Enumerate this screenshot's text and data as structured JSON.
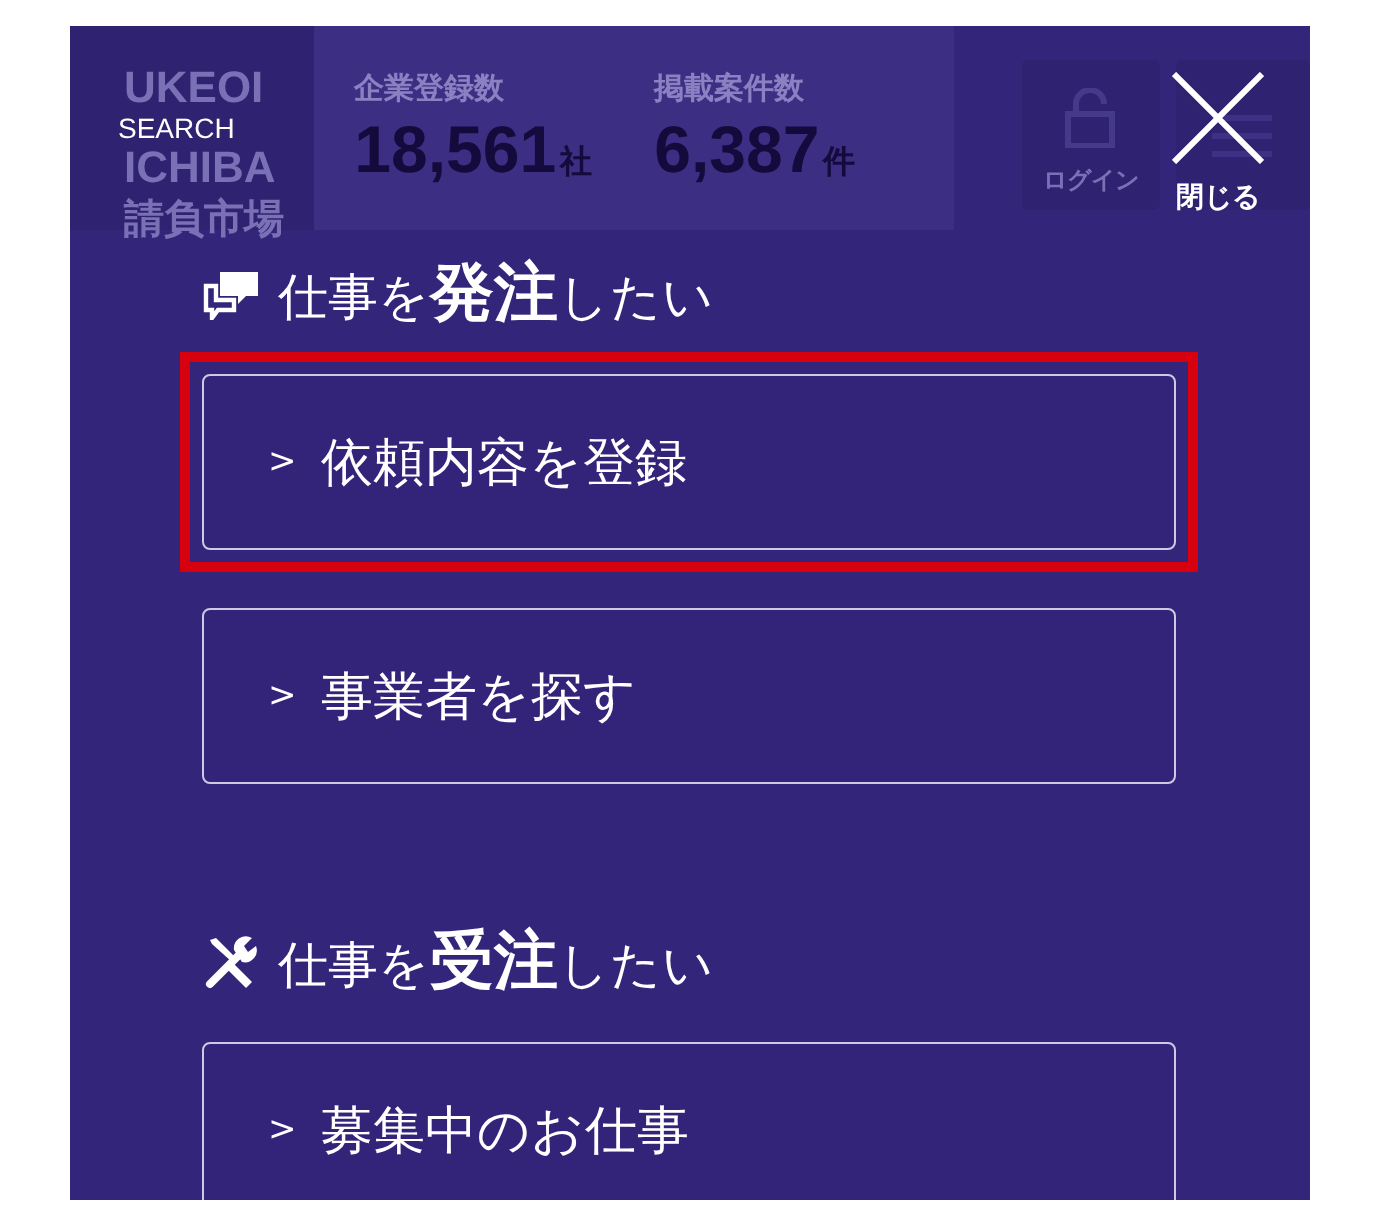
{
  "background": {
    "logo": [
      "UKEOI",
      "ICHIBA",
      "請負市場"
    ],
    "stats": [
      {
        "label": "企業登録数",
        "value": "18,561",
        "unit": "社"
      },
      {
        "label": "掲載案件数",
        "value": "6,387",
        "unit": "件"
      }
    ],
    "login_button": "ログイン"
  },
  "overlay": {
    "search_label": "SEARCH",
    "close_button": "閉じる",
    "sections": [
      {
        "kind": "order",
        "heading": {
          "before": "仕事を",
          "emphasis": "発注",
          "after": "したい"
        },
        "links": [
          {
            "marker": ">",
            "label": "依頼内容を登録",
            "highlighted": true
          },
          {
            "marker": ">",
            "label": "事業者を探す",
            "highlighted": false
          }
        ]
      },
      {
        "kind": "receive",
        "heading": {
          "before": "仕事を",
          "emphasis": "受注",
          "after": "したい"
        },
        "links": [
          {
            "marker": ">",
            "label": "募集中のお仕事",
            "highlighted": false
          }
        ]
      }
    ]
  }
}
